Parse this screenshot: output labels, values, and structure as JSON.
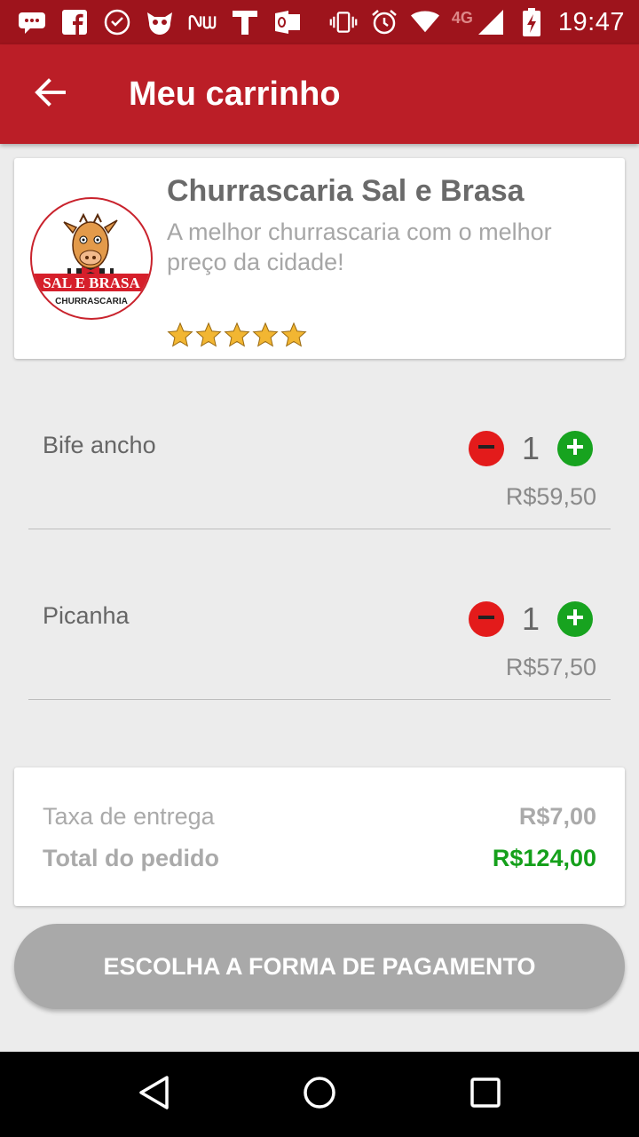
{
  "status_bar": {
    "time": "19:47",
    "network": "4G",
    "icons": [
      "chat-icon",
      "facebook-icon",
      "clock-face-icon",
      "owl-icon",
      "nubank-icon",
      "t-icon",
      "outlook-icon",
      "vibrate-icon",
      "alarm-icon",
      "wifi-icon",
      "signal-icon",
      "battery-charging-icon"
    ]
  },
  "app_bar": {
    "title": "Meu carrinho",
    "back_icon": "arrow-back-icon"
  },
  "restaurant": {
    "name": "Churrascaria Sal e Brasa",
    "description": "A melhor churrascaria com o melhor preço da cidade!",
    "rating": 5,
    "logo_text_main": "SAL E BRASA",
    "logo_text_sub": "CHURRASCARIA"
  },
  "cart": {
    "items": [
      {
        "name": "Bife ancho",
        "quantity": "1",
        "price": "R$59,50"
      },
      {
        "name": "Picanha",
        "quantity": "1",
        "price": "R$57,50"
      }
    ]
  },
  "summary": {
    "fee_label": "Taxa de entrega",
    "fee_value": "R$7,00",
    "total_label": "Total do pedido",
    "total_value": "R$124,00"
  },
  "actions": {
    "payment_button": "ESCOLHA A FORMA DE PAGAMENTO"
  },
  "colors": {
    "status_bar": "#9e141c",
    "app_bar": "#bb1e27",
    "minus": "#e31b1b",
    "plus": "#17a31f",
    "total": "#15a01b",
    "star": "#f2b632"
  }
}
